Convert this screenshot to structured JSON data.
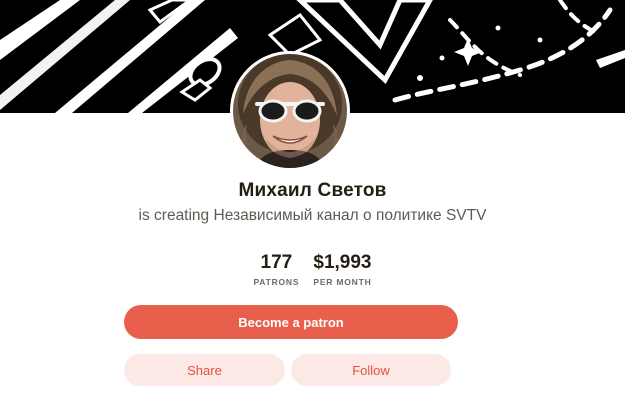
{
  "banner": {
    "alt": "cover-artwork"
  },
  "creator": {
    "name": "Михаил Светов",
    "tagline_prefix": "is creating",
    "tagline_project": " Независимый канал о политике SVTV"
  },
  "stats": [
    {
      "value": "177",
      "label": "PATRONS"
    },
    {
      "value": "$1,993",
      "label": "PER MONTH"
    }
  ],
  "actions": {
    "become_patron": "Become a patron",
    "share": "Share",
    "follow": "Follow"
  },
  "colors": {
    "accent": "#e8604c",
    "accent_soft": "#fce9e5",
    "accent_text": "#e0533f",
    "banner_bg": "#000000",
    "text_primary": "#241e12",
    "text_secondary": "#5f5a52"
  }
}
